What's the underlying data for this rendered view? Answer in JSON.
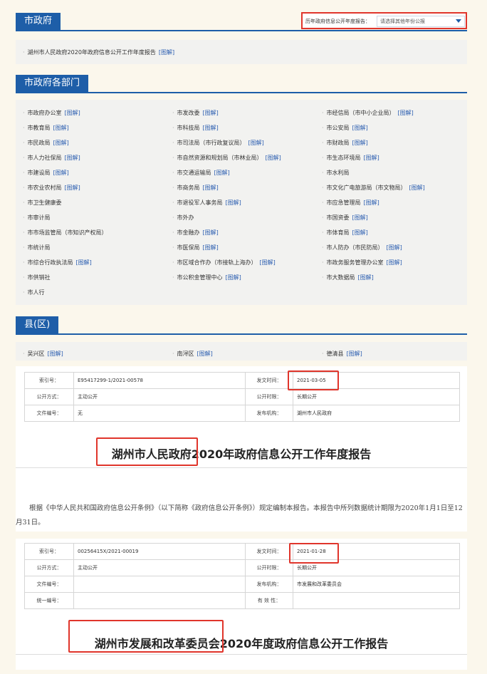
{
  "city_gov": {
    "tab_label": "市政府",
    "year_report_label": "历年政府信息公开年度报告：",
    "year_select_placeholder": "请选择其他年份公报",
    "report_item": "湖州市人民政府2020年政府信息公开工作年度报告",
    "report_link": "[图解]"
  },
  "departments": {
    "tab_label": "市政府各部门",
    "link_label": "[图解]",
    "items": [
      {
        "name": "市政府办公室",
        "link": true
      },
      {
        "name": "市发改委",
        "link": true
      },
      {
        "name": "市经信局（市中小企业局）",
        "link": true
      },
      {
        "name": "市教育局",
        "link": true
      },
      {
        "name": "市科技局",
        "link": true
      },
      {
        "name": "市公安局",
        "link": true
      },
      {
        "name": "市民政局",
        "link": true
      },
      {
        "name": "市司法局（市行政复议局）",
        "link": true
      },
      {
        "name": "市财政局",
        "link": true
      },
      {
        "name": "市人力社保局",
        "link": true
      },
      {
        "name": "市自然资源和规划局（市林业局）",
        "link": true
      },
      {
        "name": "市生态环境局",
        "link": true
      },
      {
        "name": "市建设局",
        "link": true
      },
      {
        "name": "市交通运输局",
        "link": true
      },
      {
        "name": "市水利局",
        "link": false
      },
      {
        "name": "市农业农村局",
        "link": true
      },
      {
        "name": "市商务局",
        "link": true
      },
      {
        "name": "市文化广电旅游局（市文物局）",
        "link": true
      },
      {
        "name": "市卫生健康委",
        "link": false
      },
      {
        "name": "市退役军人事务局",
        "link": true
      },
      {
        "name": "市应急管理局",
        "link": true
      },
      {
        "name": "市审计局",
        "link": false
      },
      {
        "name": "市外办",
        "link": false
      },
      {
        "name": "市国资委",
        "link": true
      },
      {
        "name": "市市场监管局（市知识产权局）",
        "link": false
      },
      {
        "name": "市金融办",
        "link": true
      },
      {
        "name": "市体育局",
        "link": true
      },
      {
        "name": "市统计局",
        "link": false
      },
      {
        "name": "市医保局",
        "link": true
      },
      {
        "name": "市人防办（市民防局）",
        "link": true
      },
      {
        "name": "市综合行政执法局",
        "link": true
      },
      {
        "name": "市区域合作办（市接轨上海办）",
        "link": true
      },
      {
        "name": "市政务服务管理办公室",
        "link": true
      },
      {
        "name": "市供销社",
        "link": false
      },
      {
        "name": "市公积金管理中心",
        "link": true
      },
      {
        "name": "市大数据局",
        "link": true
      },
      {
        "name": "市人行",
        "link": false
      }
    ]
  },
  "counties": {
    "tab_label": "县(区)",
    "items": [
      {
        "name": "吴兴区",
        "link": "[图解]"
      },
      {
        "name": "南浔区",
        "link": "[图解]"
      },
      {
        "name": "德清县",
        "link": "[图解]"
      }
    ]
  },
  "doc1": {
    "rows": [
      [
        "索引号：",
        "E95417299-1/2021-00578",
        "发文时间：",
        "2021-03-05"
      ],
      [
        "公开方式：",
        "主动公开",
        "公开时限：",
        "长期公开"
      ],
      [
        "文件编号：",
        "无",
        "发布机构：",
        "湖州市人民政府"
      ]
    ],
    "title": "湖州市人民政府2020年政府信息公开工作年度报告",
    "paragraph": "根据《中华人民共和国政府信息公开条例》（以下简称《政府信息公开条例》）规定编制本报告。本报告中所列数据统计期限为2020年1月1日至12月31日。"
  },
  "doc2": {
    "rows": [
      [
        "索引号：",
        "00256415X/2021-00019",
        "发文时间：",
        "2021-01-28"
      ],
      [
        "公开方式：",
        "主动公开",
        "公开时限：",
        "长期公开"
      ],
      [
        "文件编号：",
        "",
        "发布机构：",
        "市发展和改革委员会"
      ],
      [
        "统一编号：",
        "",
        "有 效 性：",
        ""
      ]
    ],
    "title": "湖州市发展和改革委员会2020年度政府信息公开工作报告"
  },
  "colors": {
    "accent": "#1e5ea8",
    "highlight": "#e0352b",
    "link": "#2a5db0"
  }
}
